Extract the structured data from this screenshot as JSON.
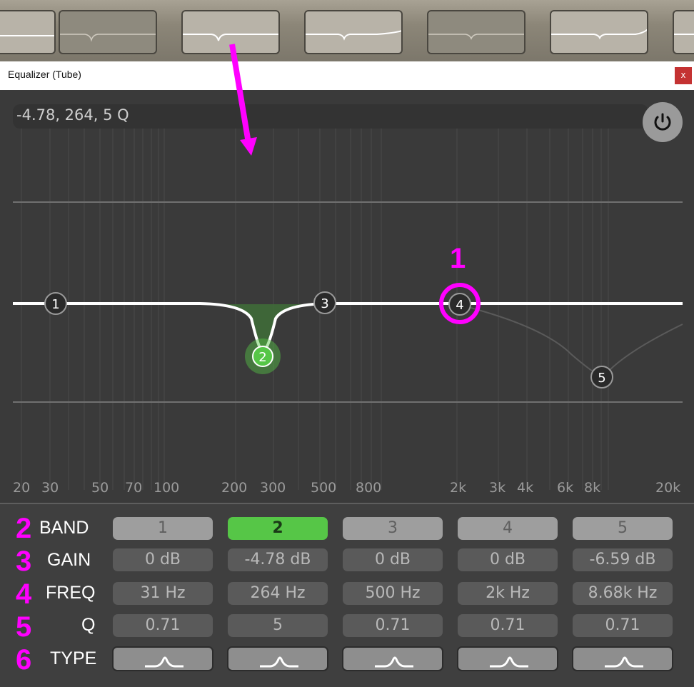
{
  "window": {
    "title": "Equalizer (Tube)",
    "close_label": "x"
  },
  "readout": "-4.78, 264, 5 Q",
  "freq_axis": [
    "20",
    "30",
    "50",
    "70",
    "100",
    "200",
    "300",
    "500",
    "800",
    "2k",
    "3k",
    "4k",
    "6k",
    "8k",
    "20k"
  ],
  "nodes": [
    "1",
    "2",
    "3",
    "4",
    "5"
  ],
  "rows": {
    "band": {
      "label": "BAND",
      "values": [
        "1",
        "2",
        "3",
        "4",
        "5"
      ],
      "active_index": 1
    },
    "gain": {
      "label": "GAIN",
      "values": [
        "0 dB",
        "-4.78 dB",
        "0 dB",
        "0 dB",
        "-6.59 dB"
      ]
    },
    "freq": {
      "label": "FREQ",
      "values": [
        "31 Hz",
        "264 Hz",
        "500 Hz",
        "2k Hz",
        "8.68k Hz"
      ]
    },
    "q": {
      "label": "Q",
      "values": [
        "0.71",
        "5",
        "0.71",
        "0.71",
        "0.71"
      ]
    },
    "type": {
      "label": "TYPE",
      "icons": [
        "bell-filter-icon",
        "bell-filter-icon",
        "bell-filter-icon",
        "bell-filter-icon",
        "bell-filter-icon"
      ]
    }
  },
  "annotations": [
    "1",
    "2",
    "3",
    "4",
    "5",
    "6"
  ],
  "colors": {
    "accent_green": "#56c647",
    "annotation": "#ff00ff",
    "close_red": "#c43232"
  }
}
